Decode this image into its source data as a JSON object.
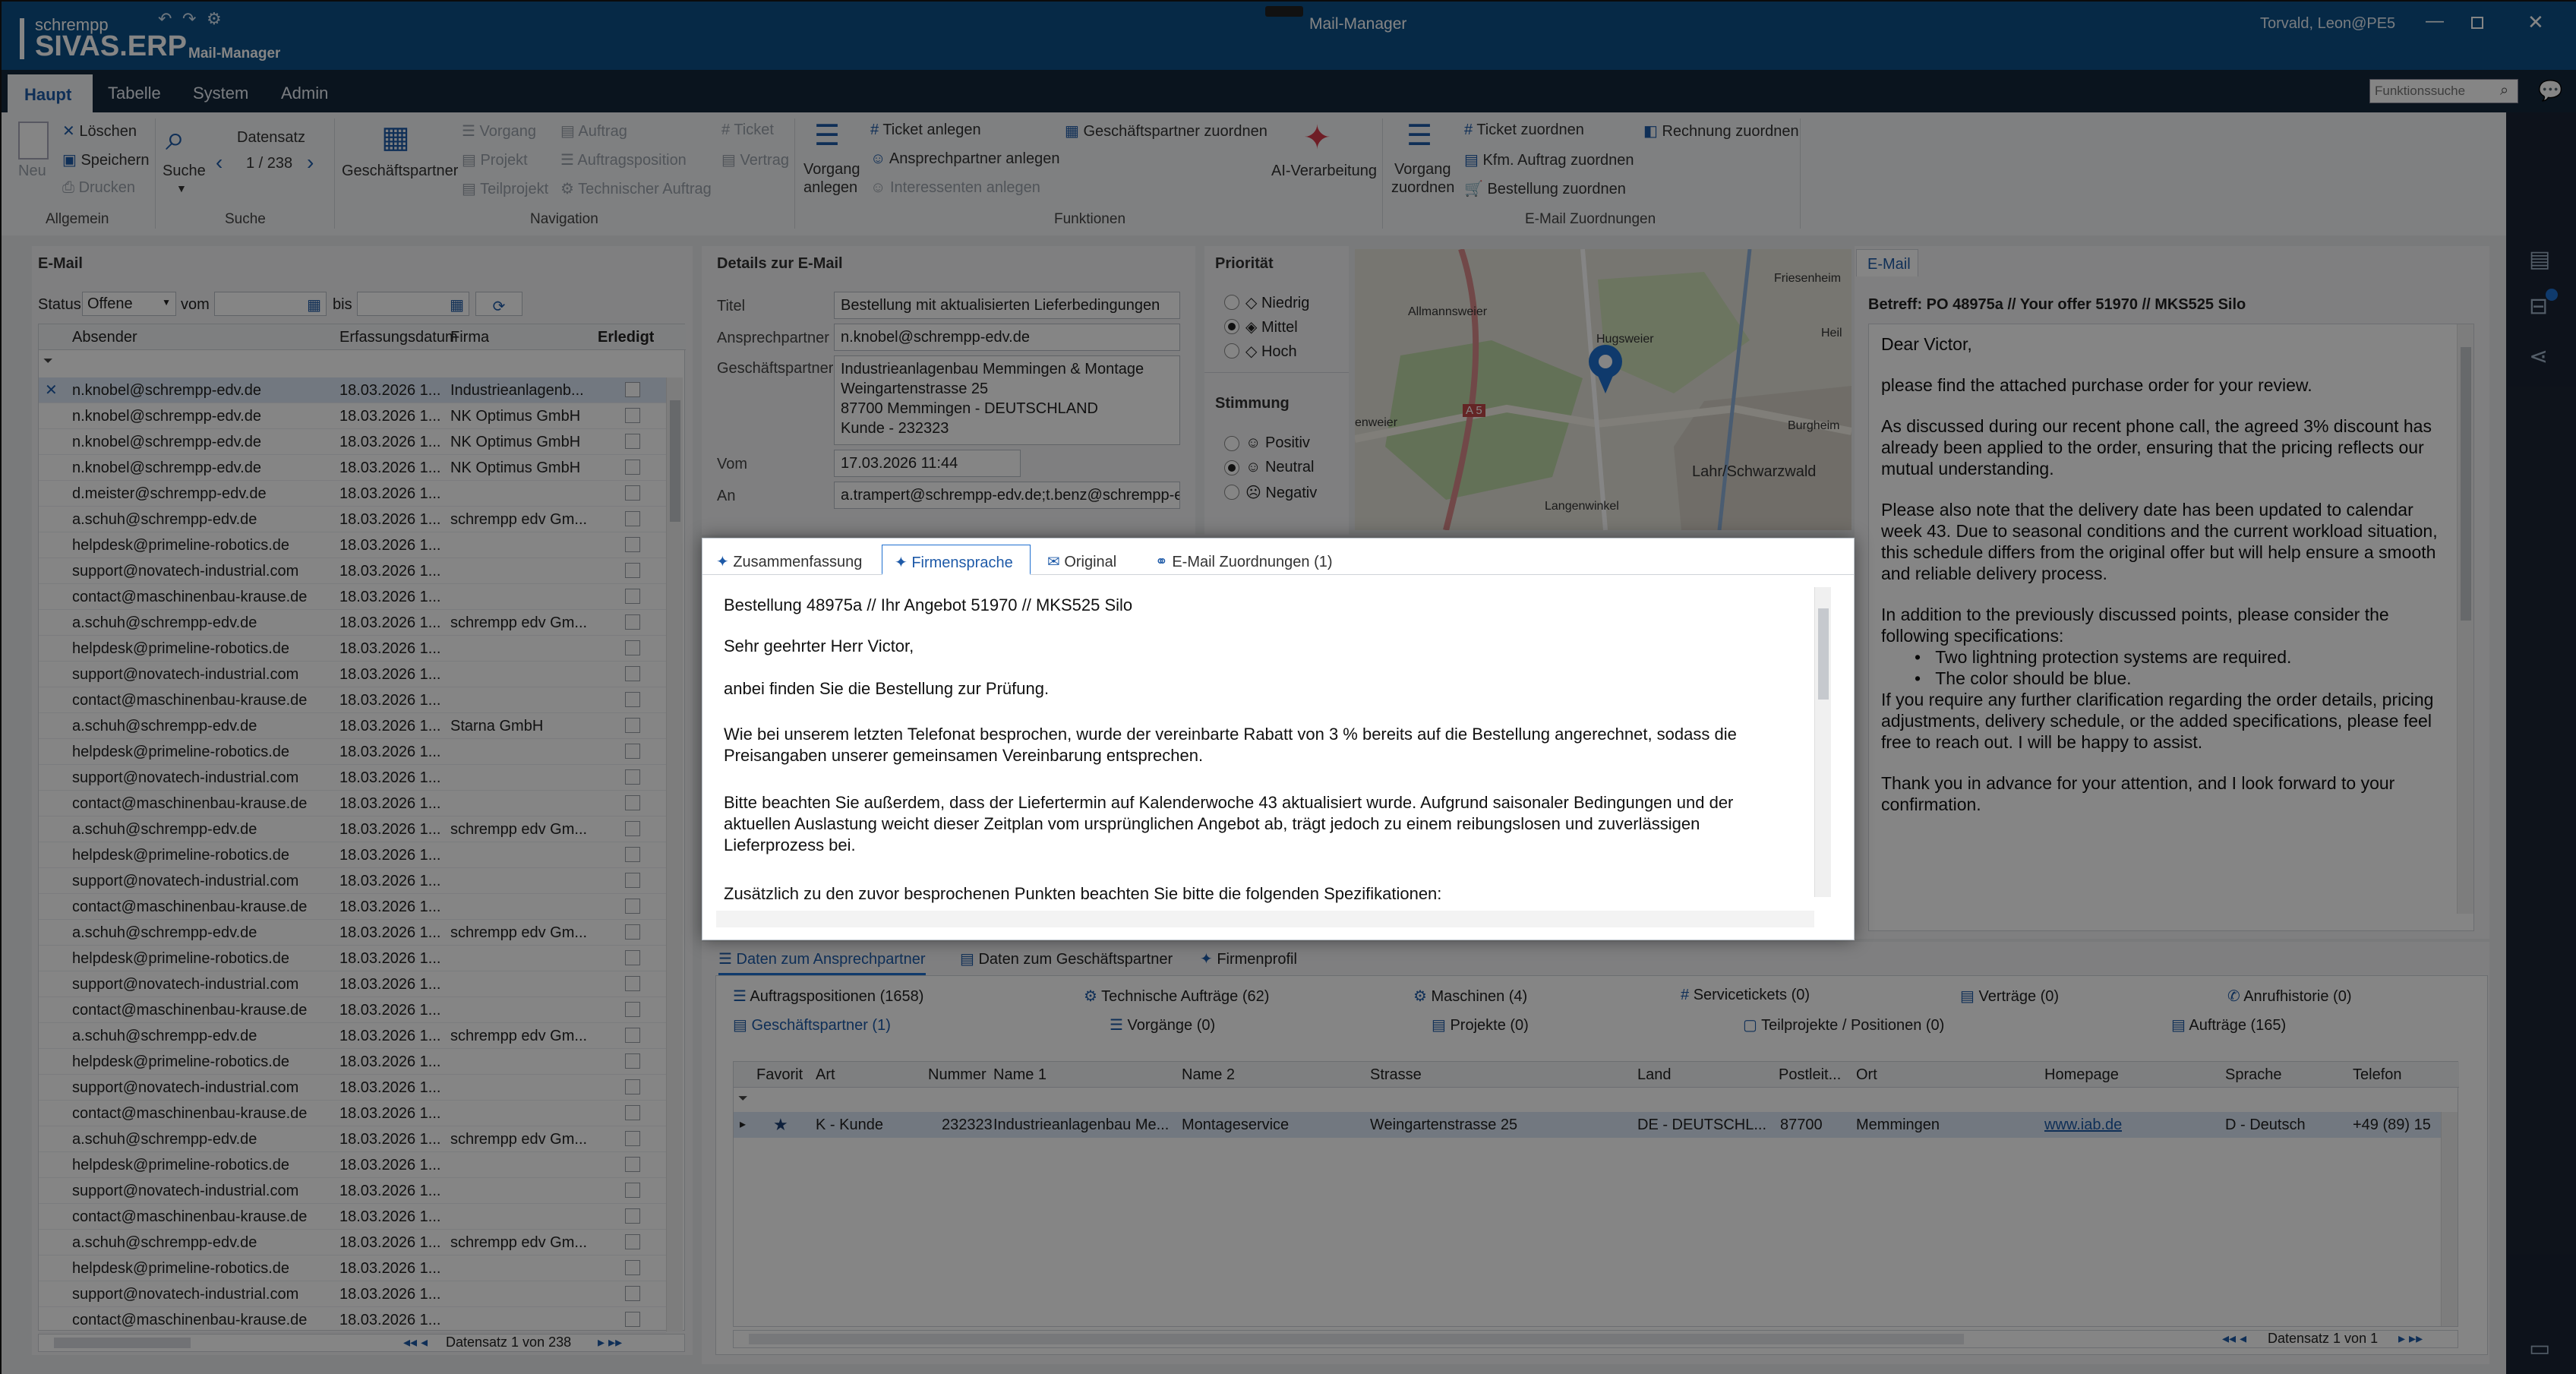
{
  "app": {
    "brand_small": "schrempp",
    "brand_big": "SIVAS.ERP",
    "module": "Mail-Manager",
    "window_title": "Mail-Manager",
    "user": "Torvald, Leon@PE5"
  },
  "main_tabs": [
    "Haupt",
    "Tabelle",
    "System",
    "Admin"
  ],
  "function_search": {
    "placeholder": "Funktionssuche"
  },
  "ribbon": {
    "allgemein": {
      "new": "Neu",
      "delete": "Löschen",
      "save": "Speichern",
      "print": "Drucken",
      "group": "Allgemein"
    },
    "suche": {
      "search": "Suche",
      "datensatz": "Datensatz",
      "counter": "1 / 238",
      "group": "Suche"
    },
    "navigation": {
      "gp": "Geschäftspartner",
      "vorgang": "Vorgang",
      "projekt": "Projekt",
      "teilprojekt": "Teilprojekt",
      "auftrag": "Auftrag",
      "auftragsposition": "Auftragsposition",
      "technischer_auftrag": "Technischer Auftrag",
      "ticket": "Ticket",
      "vertrag": "Vertrag",
      "group": "Navigation"
    },
    "funktionen": {
      "vorgang_anlegen_1": "Vorgang",
      "vorgang_anlegen_2": "anlegen",
      "ticket_anlegen": "Ticket anlegen",
      "ansprechpartner_anlegen": "Ansprechpartner anlegen",
      "interessenten_anlegen": "Interessenten anlegen",
      "gp_zuordnen": "Geschäftspartner zuordnen",
      "ai": "AI-Verarbeitung",
      "group": "Funktionen"
    },
    "zuordnungen": {
      "vorgang_zuordnen_1": "Vorgang",
      "vorgang_zuordnen_2": "zuordnen",
      "ticket_zuordnen": "Ticket zuordnen",
      "kfm_auftrag": "Kfm. Auftrag zuordnen",
      "bestellung": "Bestellung zuordnen",
      "rechnung": "Rechnung zuordnen",
      "group": "E-Mail Zuordnungen"
    }
  },
  "email_panel": {
    "title": "E-Mail",
    "status_label": "Status",
    "status_value": "Offene",
    "from_label": "vom",
    "to_label": "bis",
    "columns": [
      "Absender",
      "Erfassungsdatum",
      "Firma",
      "Erledigt"
    ],
    "rows": [
      [
        "n.knobel@schrempp-edv.de",
        "18.03.2026 1...",
        "Industrieanlagenb..."
      ],
      [
        "n.knobel@schrempp-edv.de",
        "18.03.2026 1...",
        "NK Optimus GmbH"
      ],
      [
        "n.knobel@schrempp-edv.de",
        "18.03.2026 1...",
        "NK Optimus GmbH"
      ],
      [
        "n.knobel@schrempp-edv.de",
        "18.03.2026 1...",
        "NK Optimus GmbH"
      ],
      [
        "d.meister@schrempp-edv.de",
        "18.03.2026 1...",
        ""
      ],
      [
        "a.schuh@schrempp-edv.de",
        "18.03.2026 1...",
        "schrempp edv Gm..."
      ],
      [
        "helpdesk@primeline-robotics.de",
        "18.03.2026 1...",
        ""
      ],
      [
        "support@novatech-industrial.com",
        "18.03.2026 1...",
        ""
      ],
      [
        "contact@maschinenbau-krause.de",
        "18.03.2026 1...",
        ""
      ],
      [
        "a.schuh@schrempp-edv.de",
        "18.03.2026 1...",
        "schrempp edv Gm..."
      ],
      [
        "helpdesk@primeline-robotics.de",
        "18.03.2026 1...",
        ""
      ],
      [
        "support@novatech-industrial.com",
        "18.03.2026 1...",
        ""
      ],
      [
        "contact@maschinenbau-krause.de",
        "18.03.2026 1...",
        ""
      ],
      [
        "a.schuh@schrempp-edv.de",
        "18.03.2026 1...",
        "Starna GmbH"
      ],
      [
        "helpdesk@primeline-robotics.de",
        "18.03.2026 1...",
        ""
      ],
      [
        "support@novatech-industrial.com",
        "18.03.2026 1...",
        ""
      ],
      [
        "contact@maschinenbau-krause.de",
        "18.03.2026 1...",
        ""
      ],
      [
        "a.schuh@schrempp-edv.de",
        "18.03.2026 1...",
        "schrempp edv Gm..."
      ],
      [
        "helpdesk@primeline-robotics.de",
        "18.03.2026 1...",
        ""
      ],
      [
        "support@novatech-industrial.com",
        "18.03.2026 1...",
        ""
      ],
      [
        "contact@maschinenbau-krause.de",
        "18.03.2026 1...",
        ""
      ],
      [
        "a.schuh@schrempp-edv.de",
        "18.03.2026 1...",
        "schrempp edv Gm..."
      ],
      [
        "helpdesk@primeline-robotics.de",
        "18.03.2026 1...",
        ""
      ],
      [
        "support@novatech-industrial.com",
        "18.03.2026 1...",
        ""
      ],
      [
        "contact@maschinenbau-krause.de",
        "18.03.2026 1...",
        ""
      ],
      [
        "a.schuh@schrempp-edv.de",
        "18.03.2026 1...",
        "schrempp edv Gm..."
      ],
      [
        "helpdesk@primeline-robotics.de",
        "18.03.2026 1...",
        ""
      ],
      [
        "support@novatech-industrial.com",
        "18.03.2026 1...",
        ""
      ],
      [
        "contact@maschinenbau-krause.de",
        "18.03.2026 1...",
        ""
      ],
      [
        "a.schuh@schrempp-edv.de",
        "18.03.2026 1...",
        "schrempp edv Gm..."
      ],
      [
        "helpdesk@primeline-robotics.de",
        "18.03.2026 1...",
        ""
      ],
      [
        "support@novatech-industrial.com",
        "18.03.2026 1...",
        ""
      ],
      [
        "contact@maschinenbau-krause.de",
        "18.03.2026 1...",
        ""
      ],
      [
        "a.schuh@schrempp-edv.de",
        "18.03.2026 1...",
        "schrempp edv Gm..."
      ],
      [
        "helpdesk@primeline-robotics.de",
        "18.03.2026 1...",
        ""
      ],
      [
        "support@novatech-industrial.com",
        "18.03.2026 1...",
        ""
      ],
      [
        "contact@maschinenbau-krause.de",
        "18.03.2026 1...",
        ""
      ]
    ],
    "pager": "Datensatz 1 von 238"
  },
  "details": {
    "title": "Details zur E-Mail",
    "titel_label": "Titel",
    "titel_value": "Bestellung mit aktualisierten Lieferbedingungen",
    "ap_label": "Ansprechpartner",
    "ap_value": "n.knobel@schrempp-edv.de",
    "gp_label": "Geschäftspartner",
    "gp_lines": [
      "Industrieanlagenbau Memmingen & Montage",
      "Weingartenstrasse 25",
      "87700 Memmingen - DEUTSCHLAND",
      "Kunde - 232323"
    ],
    "vom_label": "Vom",
    "vom_value": "17.03.2026 11:44",
    "an_label": "An",
    "an_value": "a.trampert@schrempp-edv.de;t.benz@schrempp-edv.de"
  },
  "priority": {
    "title": "Priorität",
    "options": [
      "Niedrig",
      "Mittel",
      "Hoch"
    ],
    "selected": "Mittel"
  },
  "mood": {
    "title": "Stimmung",
    "options": [
      "Positiv",
      "Neutral",
      "Negativ"
    ],
    "selected": "Neutral"
  },
  "map": {
    "labels": [
      "Friesenheim",
      "Allmannsweier",
      "Hugsweier",
      "Heil",
      "A 5",
      "Burgheim",
      "Lahr/Schwarzwald",
      "enweier",
      "Langenwinkel"
    ]
  },
  "mail_view": {
    "tab": "E-Mail",
    "subject": "Betreff:  PO 48975a // Your offer 51970 // MKS525 Silo",
    "paragraphs": [
      "Dear Victor,",
      "please find the attached purchase order for your review.",
      "As discussed during our recent phone call, the agreed 3% discount has already been applied to the order, ensuring that the pricing reflects our mutual understanding.",
      "Please also note that the delivery date has been updated to calendar week 43. Due to seasonal conditions and the current workload situation, this schedule differs from the original offer but will help ensure a smooth and reliable delivery process.",
      "In addition to the previously discussed points, please consider the following specifications:"
    ],
    "bullets": [
      "Two lightning protection systems are required.",
      "The color should be blue."
    ],
    "after": "If you require any further clarification regarding the order details, pricing adjustments, delivery schedule, or the added specifications, please feel free to reach out. I will be happy to assist.",
    "closing": "Thank you in advance for your attention, and I look forward to your confirmation."
  },
  "modal": {
    "tabs": [
      "Zusammenfassung",
      "Firmensprache",
      "Original",
      "E-Mail Zuordnungen (1)"
    ],
    "active_tab": "Firmensprache",
    "subject": "Bestellung 48975a // Ihr Angebot 51970 // MKS525 Silo",
    "greeting": "Sehr geehrter Herr Victor,",
    "p1": "anbei finden Sie die Bestellung zur Prüfung.",
    "p2": "Wie bei unserem letzten Telefonat besprochen, wurde der vereinbarte Rabatt von 3 % bereits auf die Bestellung angerechnet, sodass die Preisangaben unserer gemeinsamen Vereinbarung entsprechen.",
    "p3": "Bitte beachten Sie außerdem, dass der Liefertermin auf Kalenderwoche 43 aktualisiert wurde. Aufgrund saisonaler Bedingungen und der aktuellen Auslastung weicht dieser Zeitplan vom ursprünglichen Angebot ab, trägt jedoch zu einem reibungslosen und zuverlässigen Lieferprozess bei.",
    "p4": "Zusätzlich zu den zuvor besprochenen Punkten beachten Sie bitte die folgenden Spezifikationen:"
  },
  "bottom": {
    "tabs": [
      "Daten zum Ansprechpartner",
      "Daten zum Geschäftspartner",
      "Firmenprofil"
    ],
    "subtabs_row1": [
      "Auftragspositionen (1658)",
      "Technische Aufträge (62)",
      "Maschinen (4)",
      "Servicetickets (0)",
      "Verträge (0)",
      "Anrufhistorie (0)"
    ],
    "subtabs_row2": [
      "Geschäftspartner (1)",
      "Vorgänge (0)",
      "Projekte (0)",
      "Teilprojekte / Positionen (0)",
      "Aufträge (165)"
    ],
    "columns": [
      "Favorit",
      "Art",
      "Nummer",
      "Name 1",
      "Name 2",
      "Strasse",
      "Land",
      "Postleit...",
      "Ort",
      "Homepage",
      "Sprache",
      "Telefon"
    ],
    "row": [
      "",
      "K - Kunde",
      "232323",
      "Industrieanlagenbau Me...",
      "Montageservice",
      "Weingartenstrasse 25",
      "DE - DEUTSCHL...",
      "87700",
      "Memmingen",
      "www.iab.de",
      "D - Deutsch",
      "+49 (89) 15"
    ],
    "pager": "Datensatz 1 von 1"
  },
  "colors": {
    "titlebar": "#0d4f86",
    "accent": "#1e6fd0",
    "tabbar": "#15273b"
  }
}
